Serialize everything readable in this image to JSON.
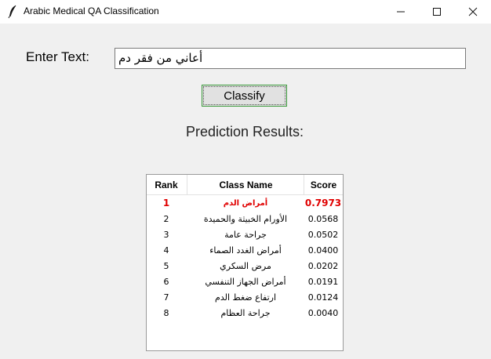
{
  "window": {
    "title": "Arabic Medical QA Classification",
    "icon": "feather-icon"
  },
  "form": {
    "enter_label": "Enter Text:",
    "input_value": "أعاني من فقر دم",
    "classify_label": "Classify"
  },
  "results": {
    "heading": "Prediction Results:",
    "headers": {
      "rank": "Rank",
      "class_name": "Class Name",
      "score": "Score"
    },
    "rows": [
      {
        "rank": "1",
        "class_name": "أمراض الدم",
        "score": "0.7973"
      },
      {
        "rank": "2",
        "class_name": "الأورام الخبيثة والحميدة",
        "score": "0.0568"
      },
      {
        "rank": "3",
        "class_name": "جراحة عامة",
        "score": "0.0502"
      },
      {
        "rank": "4",
        "class_name": "أمراض الغدد الصماء",
        "score": "0.0400"
      },
      {
        "rank": "5",
        "class_name": "مرض السكري",
        "score": "0.0202"
      },
      {
        "rank": "6",
        "class_name": "أمراض الجهاز التنفسي",
        "score": "0.0191"
      },
      {
        "rank": "7",
        "class_name": "ارتفاع ضغط الدم",
        "score": "0.0124"
      },
      {
        "rank": "8",
        "class_name": "جراحة العظام",
        "score": "0.0040"
      }
    ],
    "highlight_color": "#e00000"
  }
}
